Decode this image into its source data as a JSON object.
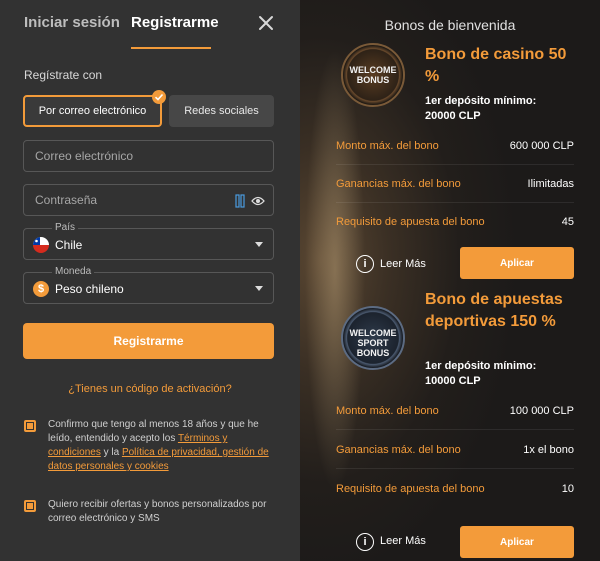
{
  "tabs": {
    "login": "Iniciar sesión",
    "register": "Registrarme"
  },
  "form": {
    "register_with": "Regístrate con",
    "method_email": "Por correo electrónico",
    "method_social": "Redes sociales",
    "email_placeholder": "Correo electrónico",
    "password_placeholder": "Contraseña",
    "country_label": "País",
    "country_value": "Chile",
    "currency_label": "Moneda",
    "currency_value": "Peso chileno",
    "currency_symbol": "$",
    "submit": "Registrarme",
    "activation_link": "¿Tienes un código de activación?",
    "terms_text": "Confirmo que tengo al menos 18 años y que he leído, entendido y acepto los",
    "terms_link": "Términos y condiciones",
    "terms_and": "y la",
    "privacy_link": "Política de privacidad, gestión de datos personales y cookies",
    "offers_text": "Quiero recibir ofertas y bonos personalizados por correo electrónico y SMS"
  },
  "bonuses": {
    "title": "Bonos de bienvenida",
    "casino": {
      "badge": "WELCOME BONUS",
      "title": "Bono de casino 50 %",
      "min_deposit": "1er depósito mínimo: 20000 CLP",
      "rows": [
        {
          "k": "Monto máx. del bono",
          "v": "600 000 CLP"
        },
        {
          "k": "Ganancias máx. del bono",
          "v": "Ilimitadas"
        },
        {
          "k": "Requisito de apuesta del bono",
          "v": "45"
        }
      ],
      "read_more": "Leer Más",
      "apply": "Aplicar"
    },
    "sport": {
      "badge": "WELCOME SPORT BONUS",
      "title": "Bono de apuestas deportivas 150 %",
      "min_deposit": "1er depósito mínimo: 10000 CLP",
      "rows": [
        {
          "k": "Monto máx. del bono",
          "v": "100 000 CLP"
        },
        {
          "k": "Ganancias máx. del bono",
          "v": "1x el bono"
        },
        {
          "k": "Requisito de apuesta del bono",
          "v": "10"
        }
      ],
      "read_more": "Leer Más",
      "apply": "Aplicar"
    }
  },
  "colors": {
    "accent": "#f39b3a",
    "panel": "#323232"
  }
}
